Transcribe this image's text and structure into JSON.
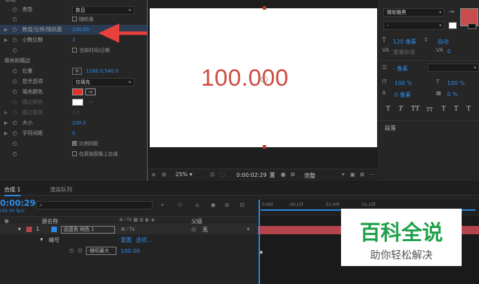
{
  "effects": {
    "header_partial": "阶段",
    "type_label": "类型",
    "type_value": "数目",
    "random_label": "随机值",
    "value_label": "数值/位移/随机最",
    "value_value": "100.00",
    "decimals_label": "小数位数",
    "decimals_value": "3",
    "current_time_label": "当前时间/日期",
    "fill_stroke_label": "填充和描边",
    "position_label": "位置",
    "position_value": "1168.0,540.0",
    "display_label": "显示选项",
    "display_value": "仅填充",
    "fill_color_label": "填充颜色",
    "stroke_color_label": "描边颜色",
    "stroke_width_label": "描边宽度",
    "stroke_width_value": "2.0",
    "size_label": "大小",
    "size_value": "200.0",
    "tracking_label": "字符间距",
    "tracking_value": "0",
    "proportional_label": "比例间距",
    "composite_label": "在原始图像上合成"
  },
  "viewer": {
    "display_text": "100.000",
    "zoom": "25%",
    "timecode": "0:00:02:29",
    "quality": "完整"
  },
  "character": {
    "font_name": "微软雅黑",
    "font_style": "-",
    "font_size": "120 像素",
    "leading": "自动",
    "kerning": "度量标准",
    "tracking": "0",
    "stroke_width": "- 像素",
    "vscale": "100 %",
    "hscale": "100 %",
    "baseline": "0 像素",
    "tsume": "0 %",
    "style_buttons": [
      "T",
      "T",
      "TT",
      "TT",
      "T",
      "T",
      "T"
    ],
    "paragraph_label": "段落"
  },
  "timeline": {
    "tab_comp": "合成 1",
    "tab_render": "渲染队列",
    "timecode": "0:00:29",
    "fps": "(30.00 fps)",
    "col_source": "源名称",
    "col_parent": "父级",
    "layer_num": "1",
    "layer_name": "品蓝色 纯色 1",
    "parent_value": "无",
    "sub_numbers": "编号",
    "reset_label": "重置",
    "options_label": "选项...",
    "prop_name": "-随机最大",
    "prop_value": "100.00",
    "ruler": [
      "0:00f",
      "00:15f",
      "01:00f",
      "01:15f"
    ]
  },
  "watermark": {
    "title": "百科全说",
    "subtitle": "助你轻松解决"
  },
  "colors": {
    "accent_blue": "#2d8ceb",
    "fill_red": "#e0322b",
    "arrow_red": "#e8403a",
    "text_red": "#cf4a40",
    "swatch_red": "#c94c4c",
    "layer_red": "#b5454d",
    "watermark_green": "#1fa04a"
  },
  "icons": {
    "stopwatch": "stopwatch-icon",
    "eyedropper": "eyedropper-icon",
    "search": "search-icon",
    "camera": "camera-icon"
  }
}
